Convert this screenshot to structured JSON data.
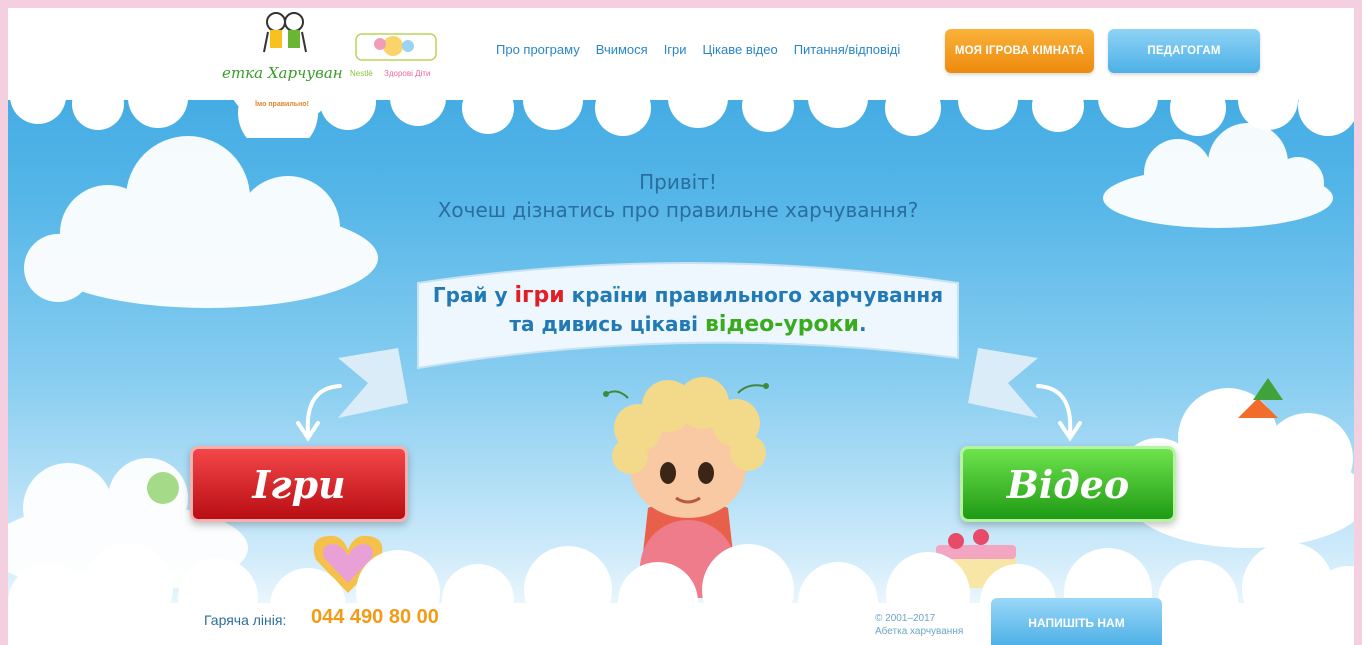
{
  "header": {
    "logo": {
      "title": "Абетка Харчування",
      "tagline": "Їмо правильно!"
    },
    "partner_logo": {
      "text_1": "Nestlé",
      "text_2": "Здорові Діти"
    },
    "nav": [
      {
        "label": "Про програму"
      },
      {
        "label": "Вчимося"
      },
      {
        "label": "Ігри"
      },
      {
        "label": "Цікаве відео"
      },
      {
        "label": "Питання/відповіді"
      }
    ],
    "my_room_label": "МОЯ ІГРОВА КІМНАТА",
    "teachers_label": "ПЕДАГОГАМ"
  },
  "hero": {
    "greeting_line1": "Привіт!",
    "greeting_line2": "Хочеш дізнатись про правильне харчування?",
    "banner": {
      "part1": "Грай у ",
      "games_word": "ігри",
      "part2": " країни правильного харчування",
      "part3": "та дивись цікаві ",
      "video_word": "відео-уроки",
      "part4": "."
    },
    "games_button": "Ігри",
    "video_button": "Відео"
  },
  "footer": {
    "hotline_label": "Гаряча лінія:",
    "hotline_number": "044 490 80 00",
    "copyright_line1": "© 2001–2017",
    "copyright_line2": "Абетка харчування",
    "write_button": "НАПИШІТЬ НАМ"
  },
  "colors": {
    "sky_top": "#36a3df",
    "accent_orange": "#ee8a0d",
    "accent_blue": "#4db0e6",
    "games_red": "#e01f26",
    "video_green": "#3aaa1f"
  }
}
